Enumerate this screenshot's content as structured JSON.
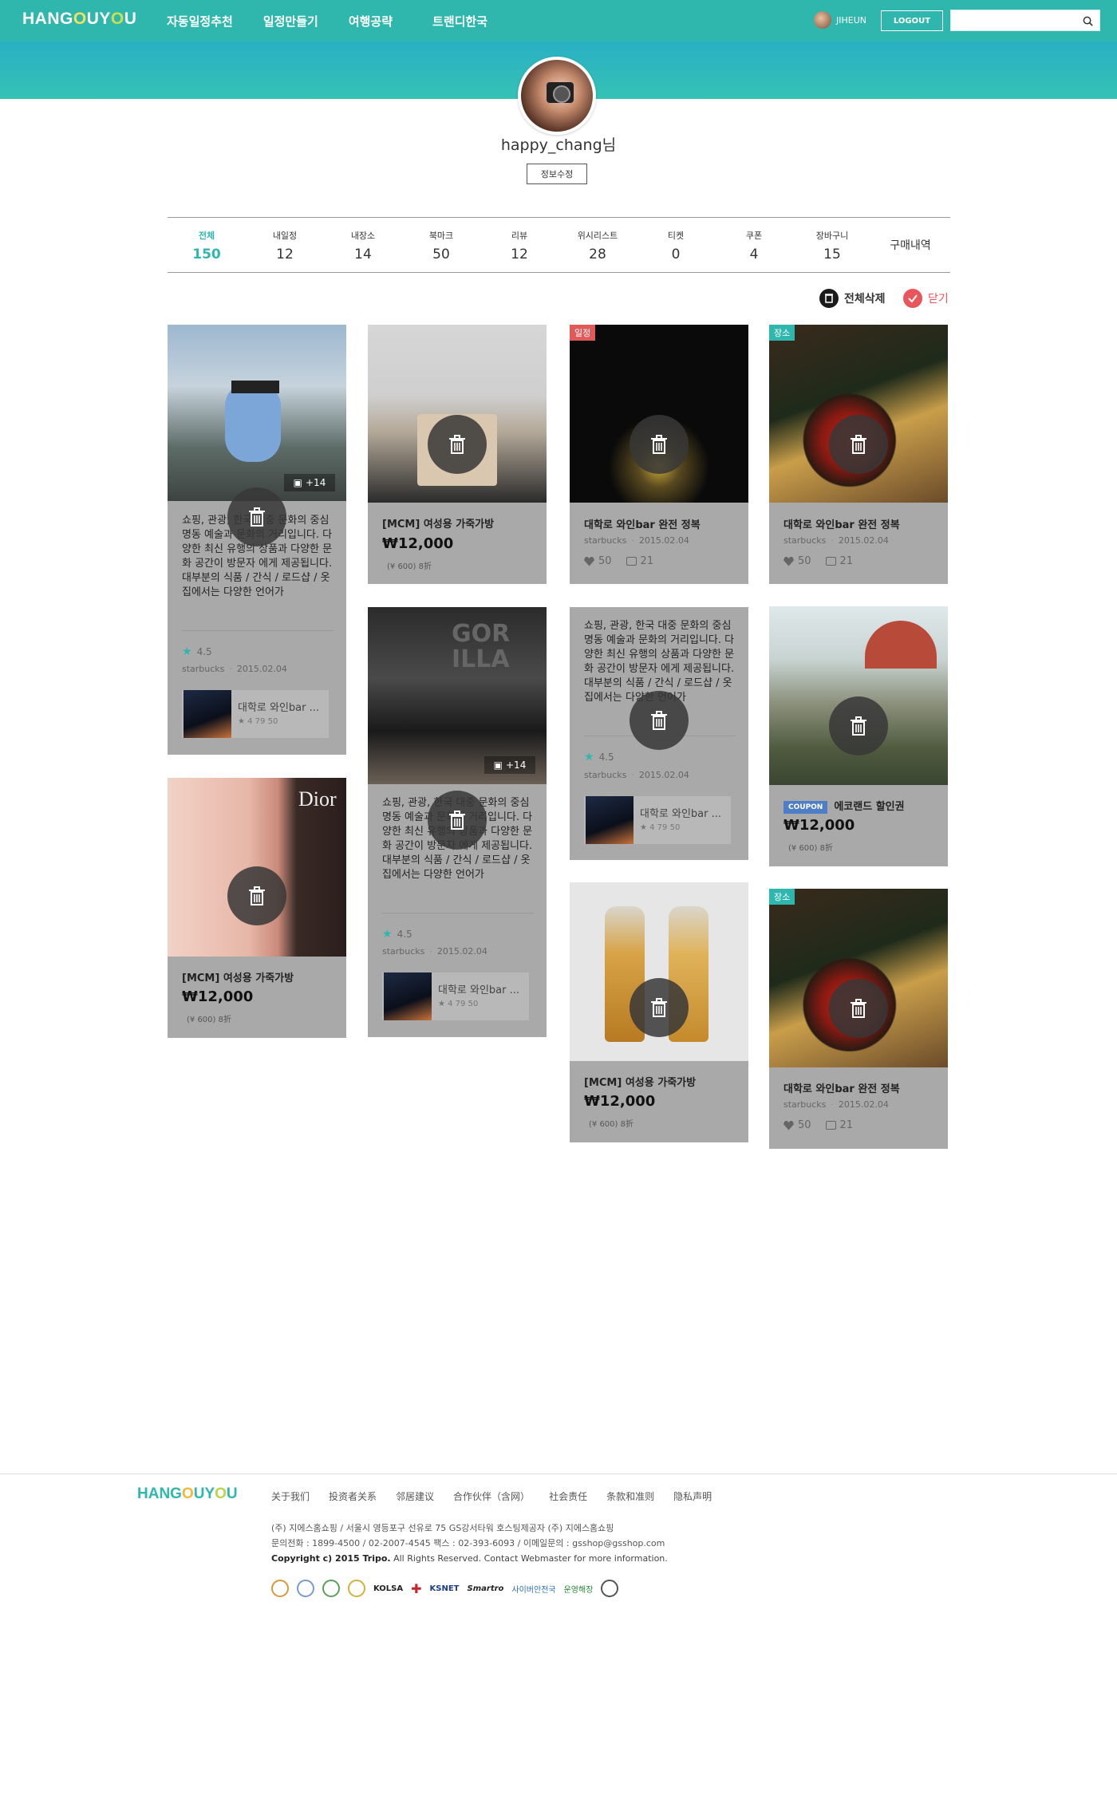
{
  "header": {
    "logo_pre": "HANG",
    "logo_o1": "O",
    "logo_mid": "UY",
    "logo_o2": "O",
    "logo_post": "U",
    "nav": [
      "자동일정추천",
      "일정만들기",
      "여행공략",
      "트랜디한국"
    ],
    "user_name": "JIHEUN",
    "logout_label": "LOGOUT",
    "search_placeholder": ""
  },
  "profile": {
    "username": "happy_chang님",
    "edit_label": "정보수정"
  },
  "tabs": [
    {
      "label": "전체",
      "count": "150",
      "active": true
    },
    {
      "label": "내일정",
      "count": "12"
    },
    {
      "label": "내장소",
      "count": "14"
    },
    {
      "label": "북마크",
      "count": "50"
    },
    {
      "label": "리뷰",
      "count": "12"
    },
    {
      "label": "위시리스트",
      "count": "28"
    },
    {
      "label": "티켓",
      "count": "0"
    },
    {
      "label": "쿠폰",
      "count": "4"
    },
    {
      "label": "장바구니",
      "count": "15"
    },
    {
      "label": "구매내역"
    }
  ],
  "actions": {
    "delete_all": "전체삭제",
    "close": "닫기"
  },
  "review_text": "쇼핑, 관광, 한국 대중 문화의 중심 명동 예술과 문화의 거리입니다. 다양한 최신 유행의 상품과 다양한 문화 공간이 방문자 에게 제공됩니다. 대부분의 식품 / 간식 / 로드샵 / 옷집에서는 다양한 언어가",
  "cards": {
    "c1": {
      "photo_count": "+14",
      "rating": "4.5",
      "author": "starbucks",
      "date": "2015.02.04",
      "related_title": "대학로 와인bar ...",
      "related_stats": "★ 4   79   50"
    },
    "c2": {
      "title": "[MCM] 여성용 가죽가방",
      "price": "₩12,000",
      "sub": "(¥ 600) 8折"
    },
    "c3": {
      "badge": "일정",
      "title": "대학로 와인bar 완전 정복",
      "author": "starbucks",
      "date": "2015.02.04",
      "likes": "50",
      "comments": "21"
    },
    "c4": {
      "badge": "장소",
      "title": "대학로 와인bar 완전 정복",
      "author": "starbucks",
      "date": "2015.02.04",
      "likes": "50",
      "comments": "21"
    },
    "c5": {
      "title": "[MCM] 여성용 가죽가방",
      "price": "₩12,000",
      "sub": "(¥ 600) 8折",
      "img_text": "Dior"
    },
    "c6": {
      "photo_count": "+14",
      "rating": "4.5",
      "author": "starbucks",
      "date": "2015.02.04",
      "related_title": "대학로 와인bar ...",
      "related_stats": "★ 4   79   50"
    },
    "c7": {
      "rating": "4.5",
      "author": "starbucks",
      "date": "2015.02.04",
      "related_title": "대학로 와인bar ...",
      "related_stats": "★ 4   79   50"
    },
    "c8": {
      "coupon": "COUPON",
      "title": "에코랜드 할인권",
      "price": "₩12,000",
      "sub": "(¥ 600) 8折"
    },
    "c9": {
      "title": "[MCM] 여성용 가죽가방",
      "price": "₩12,000",
      "sub": "(¥ 600) 8折"
    },
    "c10": {
      "badge": "장소",
      "title": "대학로 와인bar 완전 정복",
      "author": "starbucks",
      "date": "2015.02.04",
      "likes": "50",
      "comments": "21"
    }
  },
  "footer": {
    "links": [
      "关于我们",
      "投资者关系",
      "邻居建议",
      "合作伙伴（含网）",
      "社会责任",
      "条款和准则",
      "隐私声明"
    ],
    "line1": "(주) 지에스홈쇼핑  / 서울시 영등포구 선유로 75 GS강서타워 호스팅제공자 (주) 지에스홈쇼핑",
    "line2": "문의전화 : 1899-4500 / 02-2007-4545 팩스 : 02-393-6093 / 이메일문의 : gsshop@gsshop.com",
    "copy_bold": "Copyright c) 2015 Tripo.",
    "copy_rest": " All Rights Reserved. Contact Webmaster for more information.",
    "certs": [
      "KOLSA",
      "KSNET",
      "Smartro",
      "사이버안전국",
      "운영해장"
    ]
  }
}
